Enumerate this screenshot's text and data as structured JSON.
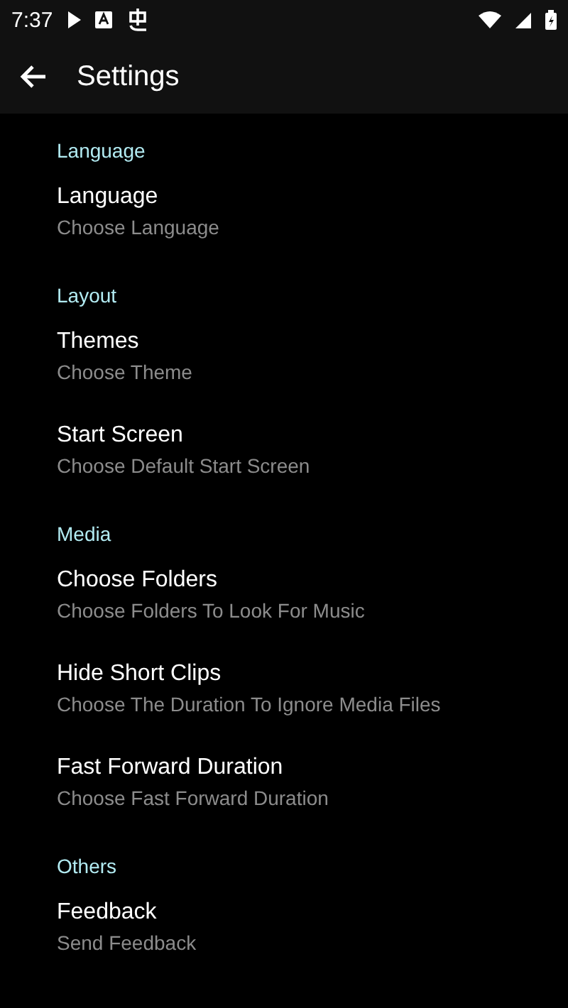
{
  "status_bar": {
    "time": "7:37"
  },
  "app_bar": {
    "title": "Settings"
  },
  "sections": [
    {
      "header": "Language",
      "items": [
        {
          "title": "Language",
          "subtitle": "Choose Language"
        }
      ]
    },
    {
      "header": "Layout",
      "items": [
        {
          "title": "Themes",
          "subtitle": "Choose Theme"
        },
        {
          "title": "Start Screen",
          "subtitle": "Choose Default Start Screen"
        }
      ]
    },
    {
      "header": "Media",
      "items": [
        {
          "title": "Choose Folders",
          "subtitle": "Choose Folders To Look For Music"
        },
        {
          "title": "Hide Short Clips",
          "subtitle": "Choose The Duration To Ignore Media Files"
        },
        {
          "title": "Fast Forward Duration",
          "subtitle": "Choose Fast Forward Duration"
        }
      ]
    },
    {
      "header": "Others",
      "items": [
        {
          "title": "Feedback",
          "subtitle": "Send Feedback"
        }
      ]
    }
  ]
}
